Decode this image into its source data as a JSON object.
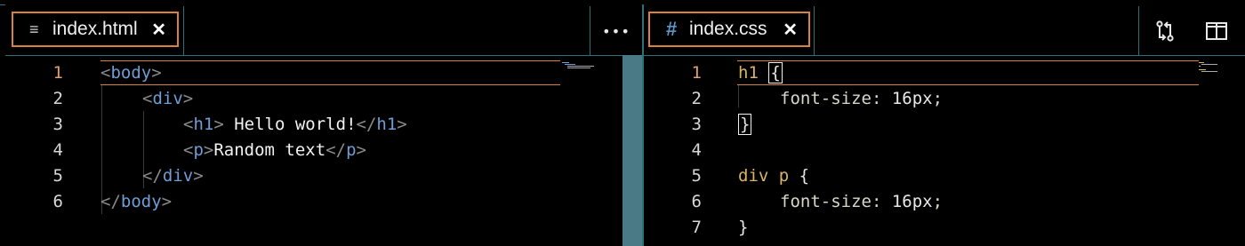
{
  "left_pane": {
    "tab": {
      "label": "index.html",
      "close": "✕",
      "icon": "lines-icon"
    },
    "more": "•••",
    "lines": [
      {
        "n": "1"
      },
      {
        "n": "2"
      },
      {
        "n": "3"
      },
      {
        "n": "4"
      },
      {
        "n": "5"
      },
      {
        "n": "6"
      }
    ]
  },
  "right_pane": {
    "tab": {
      "label": "index.css",
      "close": "✕",
      "icon": "#"
    },
    "lines": [
      {
        "n": "1"
      },
      {
        "n": "2"
      },
      {
        "n": "3"
      },
      {
        "n": "4"
      },
      {
        "n": "5"
      },
      {
        "n": "6"
      },
      {
        "n": "7"
      }
    ]
  },
  "html_code": {
    "l1_open": "<",
    "l1_tag": "body",
    "l1_close": ">",
    "l2_open": "<",
    "l2_tag": "div",
    "l2_close": ">",
    "l3_open": "<",
    "l3_tag": "h1",
    "l3_close": ">",
    "l3_text": " Hello world!",
    "l3_end_open": "</",
    "l3_end_tag": "h1",
    "l3_end_close": ">",
    "l4_open": "<",
    "l4_tag": "p",
    "l4_close": ">",
    "l4_text": "Random text",
    "l4_end_open": "</",
    "l4_end_tag": "p",
    "l4_end_close": ">",
    "l5_open": "</",
    "l5_tag": "div",
    "l5_close": ">",
    "l6_open": "</",
    "l6_tag": "body",
    "l6_close": ">"
  },
  "css_code": {
    "r1_sel": "h1",
    "r1_brace": "{",
    "r2_prop": "font-size",
    "r2_colon": ": ",
    "r2_val": "16px",
    "r2_semi": ";",
    "r3_brace": "}",
    "r5_sel": "div p",
    "r5_brace": "{",
    "r6_prop": "font-size",
    "r6_colon": ": ",
    "r6_val": "16px",
    "r6_semi": ";",
    "r7_brace": "}"
  }
}
